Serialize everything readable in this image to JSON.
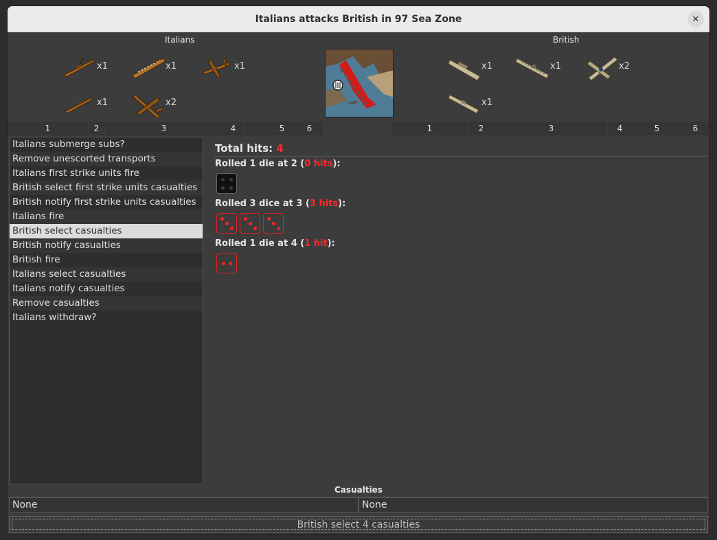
{
  "window": {
    "title": "Italians attacks British in 97 Sea Zone"
  },
  "attacker": {
    "name": "Italians",
    "units": [
      {
        "icon": "battleship-icon",
        "count": "x1"
      },
      {
        "icon": "carrier-icon",
        "count": "x1"
      },
      {
        "icon": "bomber-icon",
        "count": "x1"
      },
      {
        "icon": "destroyer-icon",
        "count": "x1"
      },
      {
        "icon": "fighter-icon",
        "count": "x2"
      }
    ]
  },
  "defender": {
    "name": "British",
    "units": [
      {
        "icon": "transport-icon",
        "count": "x1"
      },
      {
        "icon": "carrier-icon",
        "count": "x1"
      },
      {
        "icon": "fighter-icon",
        "count": "x2"
      },
      {
        "icon": "battleship-icon",
        "count": "x1"
      }
    ]
  },
  "die_columns": {
    "attacker": [
      "1",
      "2",
      "3",
      "4",
      "5",
      "6"
    ],
    "defender": [
      "1",
      "2",
      "3",
      "4",
      "5",
      "6"
    ]
  },
  "steps": [
    "Italians submerge subs?",
    "Remove unescorted transports",
    "Italians first strike units fire",
    "British select first strike units casualties",
    "British notify first strike units casualties",
    "Italians fire",
    "British select casualties",
    "British notify casualties",
    "British fire",
    "Italians select casualties",
    "Italians notify casualties",
    "Remove casualties",
    "Italians withdraw?"
  ],
  "selected_step": "British select casualties",
  "results": {
    "total_label": "Total hits:",
    "total_value": "4",
    "rolls": [
      {
        "prefix": "Rolled 1 die at 2 (",
        "hits": "0 hits",
        "suffix": "):",
        "dice": [
          4
        ],
        "hit": [
          false
        ]
      },
      {
        "prefix": "Rolled 3 dice at 3 (",
        "hits": "3 hits",
        "suffix": "):",
        "dice": [
          3,
          3,
          3
        ],
        "hit": [
          true,
          true,
          true
        ]
      },
      {
        "prefix": "Rolled 1 die at 4 (",
        "hits": "1 hit",
        "suffix": "):",
        "dice": [
          2
        ],
        "hit": [
          true
        ]
      }
    ]
  },
  "casualties": {
    "header": "Casualties",
    "attacker": "None",
    "defender": "None"
  },
  "status": "British select 4 casualties",
  "colors": {
    "hit": "#ff2a2a",
    "italian_unit": "#a0621e",
    "british_unit": "#c8bc98"
  }
}
